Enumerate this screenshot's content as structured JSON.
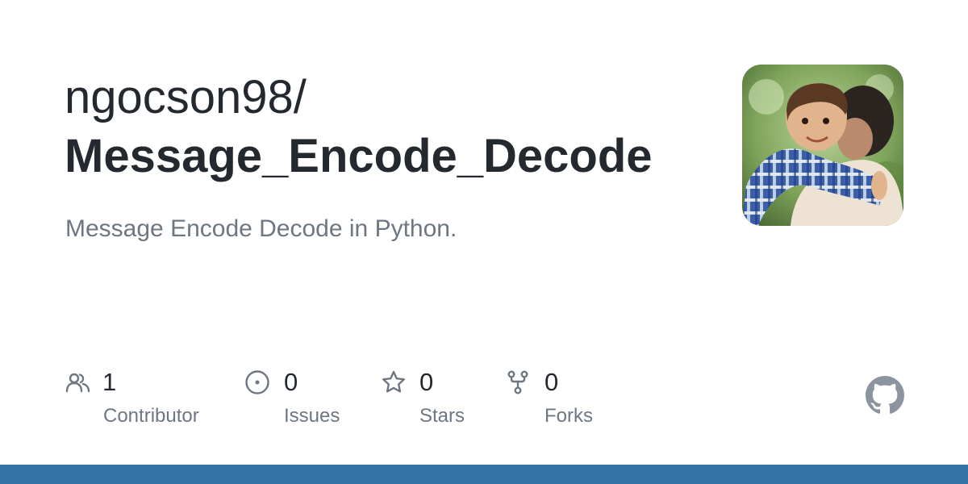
{
  "repo": {
    "owner": "ngocson98/",
    "name": "Message_Encode_Decode",
    "description": "Message Encode Decode in Python."
  },
  "stats": {
    "contributors": {
      "count": "1",
      "label": "Contributor",
      "icon": "people-icon"
    },
    "issues": {
      "count": "0",
      "label": "Issues",
      "icon": "issue-opened-icon"
    },
    "stars": {
      "count": "0",
      "label": "Stars",
      "icon": "star-icon"
    },
    "forks": {
      "count": "0",
      "label": "Forks",
      "icon": "repo-forked-icon"
    }
  },
  "language_bar": {
    "color": "#3572a5"
  },
  "colors": {
    "text": "#24292f",
    "muted": "#6e7781",
    "icon": "#6e7781"
  }
}
